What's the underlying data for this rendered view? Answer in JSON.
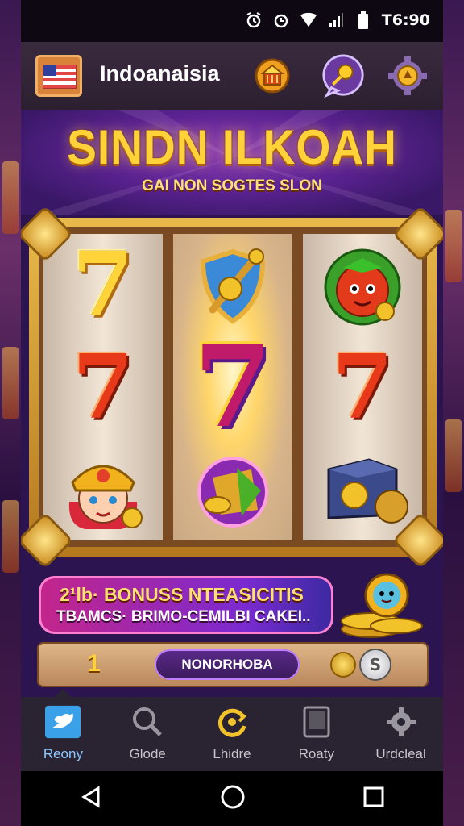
{
  "status_bar": {
    "time": "T6:90"
  },
  "header": {
    "brand": "Indoanaisia"
  },
  "game": {
    "title": "SINDN ILKOAH",
    "subtitle": "GAI NON SOGTES SLON"
  },
  "reels": [
    [
      "gold-seven",
      "shield-sword",
      "tomato-mascot"
    ],
    [
      "red-seven",
      "purple-seven",
      "red-seven"
    ],
    [
      "pharaoh-girl",
      "fruit-orb",
      "treasure-chest"
    ]
  ],
  "seven_glyph": "7",
  "bonus": {
    "line1": "2¹lb· BONUSS NTEASICITIS",
    "line2": "TBAMCS· BRIMO-CEMILBI CAKEI.."
  },
  "bet": {
    "value": "1",
    "button_label": "NONORHOBA",
    "coin_symbol": "S"
  },
  "nav": [
    {
      "label": "Reony",
      "icon": "bird-icon",
      "active": true
    },
    {
      "label": "Glode",
      "icon": "search-icon",
      "active": false
    },
    {
      "label": "Lhidre",
      "icon": "refresh-icon",
      "active": false
    },
    {
      "label": "Roaty",
      "icon": "tablet-icon",
      "active": false
    },
    {
      "label": "Urdcleal",
      "icon": "gear-icon",
      "active": false
    }
  ],
  "colors": {
    "title": "#ffd23a",
    "nav_active": "#8ec8ff",
    "background": "#2b1450"
  }
}
